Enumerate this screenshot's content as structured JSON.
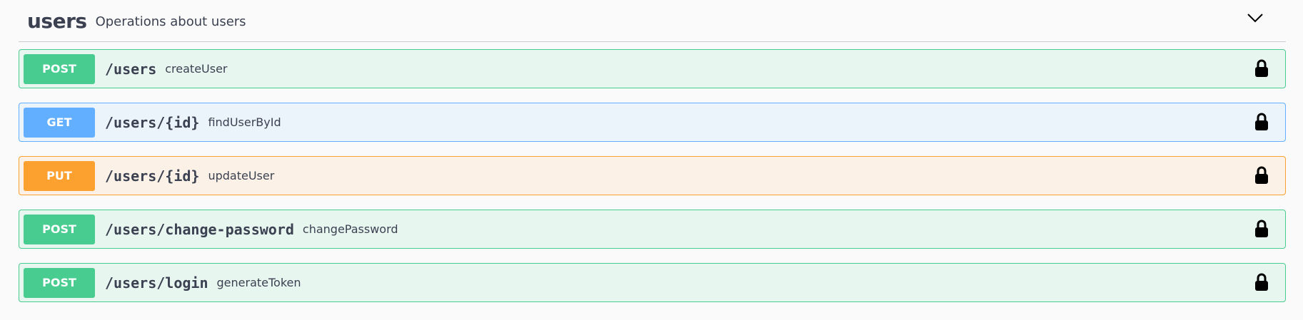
{
  "tag": {
    "name": "users",
    "description": "Operations about users"
  },
  "colors": {
    "post_badge": "#49cc90",
    "post_bg": "#e8f6f0",
    "get_badge": "#61affe",
    "get_bg": "#ebf3fb",
    "put_badge": "#fca130",
    "put_bg": "#fbf1e6"
  },
  "icons": {
    "collapse": "chevron-down-icon",
    "authorization": "lock-icon"
  },
  "operations": [
    {
      "method": "POST",
      "path": "/users",
      "summary": "createUser"
    },
    {
      "method": "GET",
      "path": "/users/{id}",
      "summary": "findUserById"
    },
    {
      "method": "PUT",
      "path": "/users/{id}",
      "summary": "updateUser"
    },
    {
      "method": "POST",
      "path": "/users/change-password",
      "summary": "changePassword"
    },
    {
      "method": "POST",
      "path": "/users/login",
      "summary": "generateToken"
    }
  ]
}
